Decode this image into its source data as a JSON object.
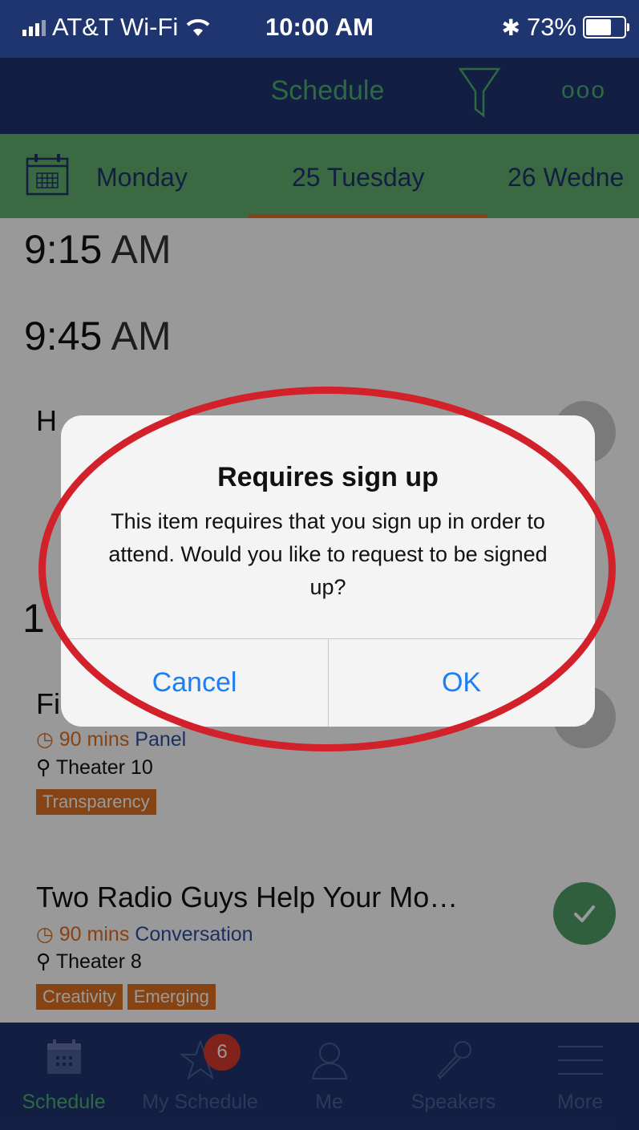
{
  "status_bar": {
    "carrier": "AT&T Wi-Fi",
    "time": "10:00 AM",
    "battery_pct": "73%",
    "battery_level": 0.73
  },
  "nav": {
    "title": "Schedule",
    "more_glyph": "ooo"
  },
  "day_tabs": [
    {
      "label": "Monday"
    },
    {
      "label": "25 Tuesday",
      "selected": true
    },
    {
      "label": "26 Wedne"
    }
  ],
  "time_slots": [
    {
      "hour": "9:15",
      "ampm": "AM"
    },
    {
      "hour": "9:45",
      "ampm": "AM"
    }
  ],
  "sessions": [
    {
      "title": "Two Radio Guys Help Your Mo…",
      "duration": "90 mins",
      "type": "Conversation",
      "location": "Theater 8",
      "tags": [
        "Creativity",
        "Emerging"
      ],
      "added": true
    },
    {
      "title_visible": "Fi",
      "duration": "90 mins",
      "type": "Panel",
      "location": "Theater 10",
      "tags": [
        "Transparency"
      ],
      "added": false
    }
  ],
  "partial": {
    "slot_fragment": "1",
    "session_fragment": "H"
  },
  "dialog": {
    "title": "Requires sign up",
    "message": "This item requires that you sign up in order to attend. Would you like to request to be signed up?",
    "cancel_label": "Cancel",
    "ok_label": "OK"
  },
  "tab_bar": {
    "items": [
      {
        "label": "Schedule",
        "icon": "calendar-icon",
        "active": true
      },
      {
        "label": "My Schedule",
        "icon": "star-icon"
      },
      {
        "label": "Me",
        "icon": "person-icon"
      },
      {
        "label": "Speakers",
        "icon": "microphone-icon"
      },
      {
        "label": "More",
        "icon": "menu-icon"
      }
    ],
    "my_schedule_badge": "6"
  },
  "colors": {
    "navy": "#1f3570",
    "green": "#4caf6f",
    "tab_green": "#62b06e",
    "orange": "#e07020",
    "ios_blue": "#1a7ef5",
    "highlight_red": "#d2212a",
    "badge_red": "#d83a2e"
  }
}
